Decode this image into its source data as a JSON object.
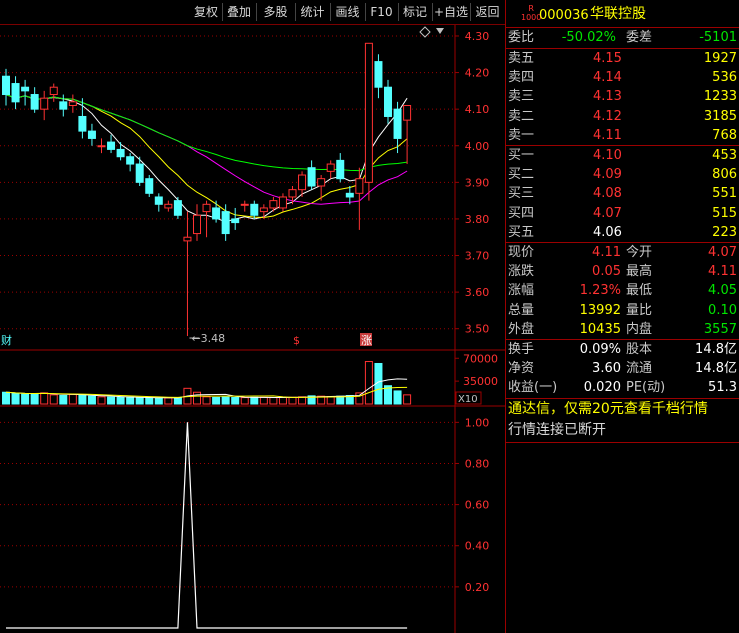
{
  "toolbar": [
    "复权",
    "叠加",
    "多股",
    "统计",
    "画线",
    "F10",
    "标记",
    "+自选",
    "返回"
  ],
  "stock": {
    "badge_top": "R",
    "badge_bottom": "1000",
    "code": "000036",
    "name": "华联控股"
  },
  "weibi": {
    "label": "委比",
    "value": "-50.02%",
    "label2": "委差",
    "value2": "-5101"
  },
  "asks": [
    {
      "label": "卖五",
      "price": "4.15",
      "vol": "1927"
    },
    {
      "label": "卖四",
      "price": "4.14",
      "vol": "536"
    },
    {
      "label": "卖三",
      "price": "4.13",
      "vol": "1233"
    },
    {
      "label": "卖二",
      "price": "4.12",
      "vol": "3185"
    },
    {
      "label": "卖一",
      "price": "4.11",
      "vol": "768"
    }
  ],
  "bids": [
    {
      "label": "买一",
      "price": "4.10",
      "vol": "453"
    },
    {
      "label": "买二",
      "price": "4.09",
      "vol": "806"
    },
    {
      "label": "买三",
      "price": "4.08",
      "vol": "551"
    },
    {
      "label": "买四",
      "price": "4.07",
      "vol": "515"
    },
    {
      "label": "买五",
      "price": "4.06",
      "vol": "223"
    }
  ],
  "quote": [
    {
      "l1": "现价",
      "v1": "4.11",
      "l2": "今开",
      "v2": "4.07"
    },
    {
      "l1": "涨跌",
      "v1": "0.05",
      "l2": "最高",
      "v2": "4.11"
    },
    {
      "l1": "涨幅",
      "v1": "1.23%",
      "l2": "最低",
      "v2": "4.05"
    },
    {
      "l1": "总量",
      "v1": "13992",
      "l2": "量比",
      "v2": "0.10"
    },
    {
      "l1": "外盘",
      "v1": "10435",
      "l2": "内盘",
      "v2": "3557"
    }
  ],
  "fund": [
    {
      "l1": "换手",
      "v1": "0.09%",
      "l2": "股本",
      "v2": "14.8亿"
    },
    {
      "l1": "净资",
      "v1": "3.60",
      "l2": "流通",
      "v2": "14.8亿"
    },
    {
      "l1": "收益(一)",
      "v1": "0.020",
      "l2": "PE(动)",
      "v2": "51.3"
    }
  ],
  "promo": "通达信，仅需20元查看千档行情",
  "status": "行情连接已断开",
  "colors": {
    "up": "#ff3232",
    "down": "#54ffff",
    "ma5": "#ffffff",
    "ma10": "#ffff00",
    "ma20": "#ff00ff",
    "ma60": "#00ff00",
    "grid": "#9b0000"
  },
  "chart_data": [
    {
      "type": "candlestick",
      "price_ticks": [
        "4.30",
        "4.20",
        "4.10",
        "4.00",
        "3.90",
        "3.80",
        "3.70",
        "3.60",
        "3.50"
      ],
      "ylim": [
        3.45,
        4.33
      ],
      "low_annotation": "3.48",
      "markers": [
        "财",
        "$",
        "涨"
      ],
      "series_ohlc": [
        [
          4.19,
          4.21,
          4.11,
          4.14
        ],
        [
          4.17,
          4.19,
          4.1,
          4.12
        ],
        [
          4.16,
          4.18,
          4.11,
          4.15
        ],
        [
          4.14,
          4.16,
          4.09,
          4.1
        ],
        [
          4.1,
          4.15,
          4.07,
          4.13
        ],
        [
          4.14,
          4.17,
          4.12,
          4.16
        ],
        [
          4.12,
          4.14,
          4.08,
          4.1
        ],
        [
          4.11,
          4.14,
          4.09,
          4.12
        ],
        [
          4.08,
          4.13,
          4.02,
          4.04
        ],
        [
          4.04,
          4.06,
          4.0,
          4.02
        ],
        [
          4.0,
          4.02,
          3.98,
          4.0
        ],
        [
          4.01,
          4.03,
          3.98,
          3.99
        ],
        [
          3.99,
          4.01,
          3.96,
          3.97
        ],
        [
          3.97,
          3.98,
          3.93,
          3.95
        ],
        [
          3.95,
          3.97,
          3.89,
          3.9
        ],
        [
          3.91,
          3.92,
          3.86,
          3.87
        ],
        [
          3.86,
          3.87,
          3.82,
          3.84
        ],
        [
          3.83,
          3.85,
          3.82,
          3.84
        ],
        [
          3.85,
          3.86,
          3.8,
          3.81
        ],
        [
          3.74,
          3.82,
          3.48,
          3.75
        ],
        [
          3.76,
          3.84,
          3.74,
          3.81
        ],
        [
          3.82,
          3.85,
          3.75,
          3.84
        ],
        [
          3.83,
          3.85,
          3.79,
          3.8
        ],
        [
          3.82,
          3.84,
          3.74,
          3.76
        ],
        [
          3.8,
          3.83,
          3.77,
          3.79
        ],
        [
          3.84,
          3.85,
          3.82,
          3.84
        ],
        [
          3.84,
          3.85,
          3.8,
          3.81
        ],
        [
          3.82,
          3.84,
          3.8,
          3.83
        ],
        [
          3.83,
          3.86,
          3.82,
          3.85
        ],
        [
          3.83,
          3.87,
          3.82,
          3.86
        ],
        [
          3.86,
          3.89,
          3.84,
          3.88
        ],
        [
          3.88,
          3.93,
          3.86,
          3.92
        ],
        [
          3.94,
          3.96,
          3.88,
          3.89
        ],
        [
          3.89,
          3.92,
          3.85,
          3.91
        ],
        [
          3.93,
          3.96,
          3.91,
          3.95
        ],
        [
          3.96,
          3.98,
          3.9,
          3.91
        ],
        [
          3.87,
          3.89,
          3.84,
          3.86
        ],
        [
          3.87,
          3.94,
          3.77,
          3.91
        ],
        [
          3.9,
          4.28,
          3.85,
          4.28
        ],
        [
          4.23,
          4.25,
          4.13,
          4.16
        ],
        [
          4.16,
          4.18,
          4.06,
          4.08
        ],
        [
          4.1,
          4.12,
          3.98,
          4.02
        ],
        [
          4.07,
          4.11,
          3.95,
          4.11
        ]
      ],
      "series_volume": [
        18000,
        16000,
        15000,
        15500,
        17000,
        14000,
        13000,
        14500,
        13000,
        12000,
        11000,
        10500,
        10000,
        10000,
        9800,
        9500,
        9000,
        9200,
        9600,
        24000,
        18000,
        11000,
        10000,
        10500,
        10000,
        9800,
        10200,
        10100,
        9900,
        10000,
        10200,
        11000,
        12500,
        12000,
        11500,
        12000,
        13000,
        17000,
        65000,
        62000,
        28000,
        20000,
        14000
      ]
    },
    {
      "type": "volume",
      "y_ticks": [
        "70000",
        "35000"
      ],
      "unit_label": "X10"
    },
    {
      "type": "line",
      "y_ticks": [
        "1.00",
        "0.80",
        "0.60",
        "0.40",
        "0.20"
      ],
      "ylim": [
        0,
        1.06
      ],
      "values": [
        0,
        0,
        0,
        0,
        0,
        0,
        0,
        0,
        0,
        0,
        0,
        0,
        0,
        0,
        0,
        0,
        0,
        0,
        0,
        1,
        0,
        0,
        0,
        0,
        0,
        0,
        0,
        0,
        0,
        0,
        0,
        0,
        0,
        0,
        0,
        0,
        0,
        0,
        0,
        0,
        0,
        0,
        0
      ]
    }
  ]
}
